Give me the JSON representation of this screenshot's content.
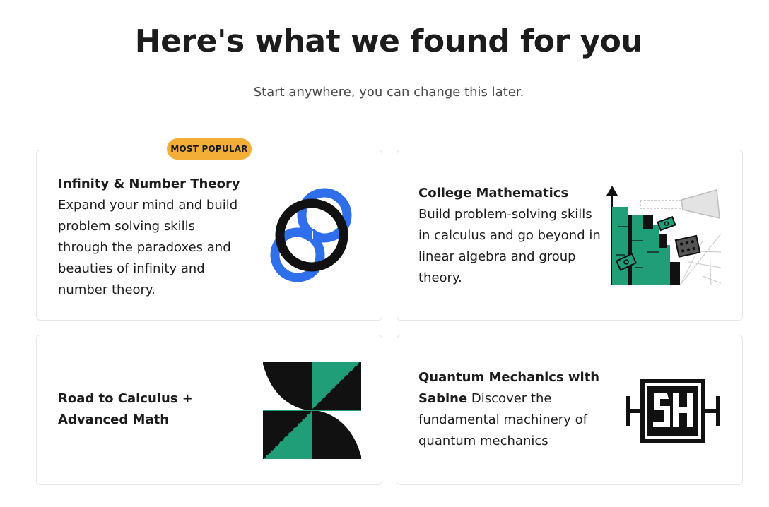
{
  "header": {
    "title": "Here's what we found for you",
    "subtitle": "Start anywhere, you can change this later."
  },
  "cards": [
    {
      "title": "Infinity & Number Theory",
      "description": "Expand your mind and build problem solving skills through the paradoxes and beauties of infinity and number theory.",
      "badge": "MOST POPULAR",
      "icon": "interlocking-rings-icon"
    },
    {
      "title": "College Mathematics",
      "description": "Build problem-solving skills in calculus and go beyond in linear algebra and group theory.",
      "icon": "calculus-collage-icon"
    },
    {
      "title": "Road to Calculus + Advanced Math",
      "description": "",
      "icon": "calculus-tile-icon"
    },
    {
      "title": "Quantum Mechanics with Sabine",
      "description": "Discover the fundamental machinery of quantum mechanics",
      "icon": "sh-monogram-icon"
    }
  ],
  "colors": {
    "badge": "#f2ae36",
    "blue": "#2f6fec",
    "green": "#1f9e78"
  }
}
